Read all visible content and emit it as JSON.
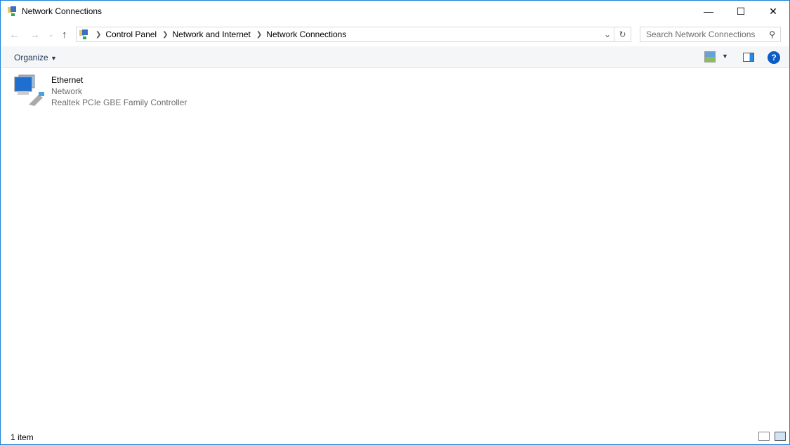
{
  "window": {
    "title": "Network Connections"
  },
  "address": {
    "crumbs": [
      "Control Panel",
      "Network and Internet",
      "Network Connections"
    ]
  },
  "search": {
    "placeholder": "Search Network Connections"
  },
  "toolbar": {
    "organize": "Organize"
  },
  "items": [
    {
      "name": "Ethernet",
      "status": "Network",
      "device": "Realtek PCIe GBE Family Controller"
    }
  ],
  "statusbar": {
    "count": "1 item"
  }
}
